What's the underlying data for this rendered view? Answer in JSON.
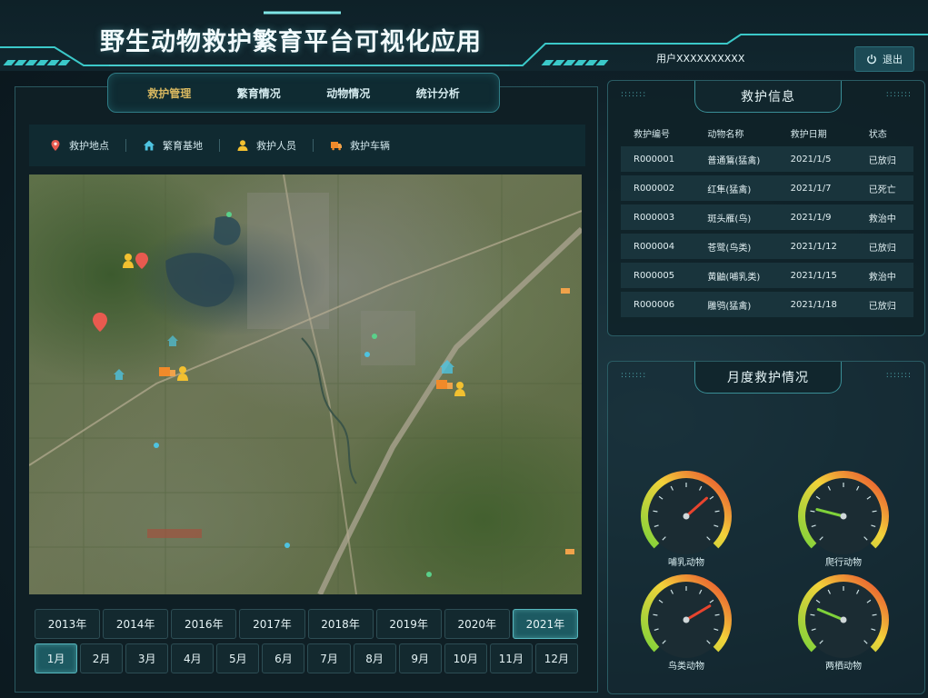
{
  "header": {
    "title": "野生动物救护繁育平台可视化应用",
    "user": "用户XXXXXXXXXX",
    "logout_label": "退出"
  },
  "nav": {
    "tabs": [
      {
        "label": "救护管理",
        "active": true
      },
      {
        "label": "繁育情况",
        "active": false
      },
      {
        "label": "动物情况",
        "active": false
      },
      {
        "label": "统计分析",
        "active": false
      }
    ]
  },
  "legend": [
    {
      "label": "救护地点",
      "icon": "location-pin-icon",
      "color": "#e85a4f"
    },
    {
      "label": "繁育基地",
      "icon": "home-icon",
      "color": "#4ec3e0"
    },
    {
      "label": "救护人员",
      "icon": "person-icon",
      "color": "#f2c030"
    },
    {
      "label": "救护车辆",
      "icon": "truck-icon",
      "color": "#f08a2a"
    }
  ],
  "years": [
    {
      "label": "2013年",
      "active": false
    },
    {
      "label": "2014年",
      "active": false
    },
    {
      "label": "2016年",
      "active": false
    },
    {
      "label": "2017年",
      "active": false
    },
    {
      "label": "2018年",
      "active": false
    },
    {
      "label": "2019年",
      "active": false
    },
    {
      "label": "2020年",
      "active": false
    },
    {
      "label": "2021年",
      "active": true
    }
  ],
  "months": [
    {
      "label": "1月",
      "active": true
    },
    {
      "label": "2月",
      "active": false
    },
    {
      "label": "3月",
      "active": false
    },
    {
      "label": "4月",
      "active": false
    },
    {
      "label": "5月",
      "active": false
    },
    {
      "label": "6月",
      "active": false
    },
    {
      "label": "7月",
      "active": false
    },
    {
      "label": "8月",
      "active": false
    },
    {
      "label": "9月",
      "active": false
    },
    {
      "label": "10月",
      "active": false
    },
    {
      "label": "11月",
      "active": false
    },
    {
      "label": "12月",
      "active": false
    }
  ],
  "rescue_info": {
    "title": "救护信息",
    "columns": [
      "救护编号",
      "动物名称",
      "救护日期",
      "状态"
    ],
    "rows": [
      [
        "R000001",
        "普通鵟(猛禽)",
        "2021/1/5",
        "已放归"
      ],
      [
        "R000002",
        "红隼(猛禽)",
        "2021/1/7",
        "已死亡"
      ],
      [
        "R000003",
        "斑头雁(鸟)",
        "2021/1/9",
        "救治中"
      ],
      [
        "R000004",
        "苍鹭(鸟类)",
        "2021/1/12",
        "已放归"
      ],
      [
        "R000005",
        "黄鼬(哺乳类)",
        "2021/1/15",
        "救治中"
      ],
      [
        "R000006",
        "雕鸮(猛禽)",
        "2021/1/18",
        "已放归"
      ]
    ]
  },
  "monthly": {
    "title": "月度救护情况",
    "gauges": [
      {
        "label": "哺乳动物",
        "value": 0.68
      },
      {
        "label": "爬行动物",
        "value": 0.22
      },
      {
        "label": "鸟类动物",
        "value": 0.72
      },
      {
        "label": "两栖动物",
        "value": 0.25
      }
    ]
  },
  "colors": {
    "accent": "#3bc9c9",
    "active_tab_text": "#d8b860",
    "panel_border": "#2a5c64"
  }
}
